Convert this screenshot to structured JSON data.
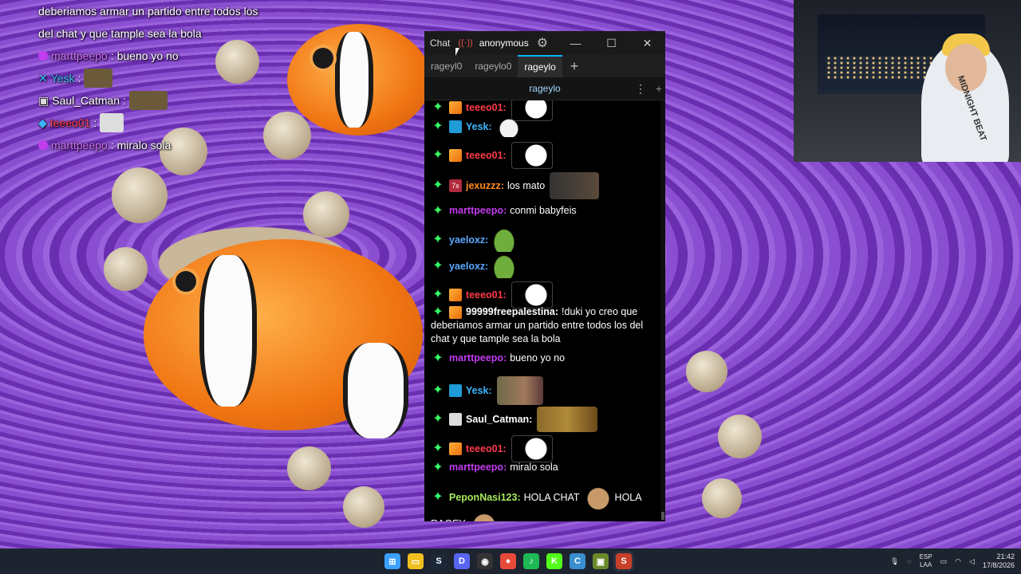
{
  "overlay_chat": {
    "line1": "deberiamos armar un partido entre todos los",
    "line2": "del chat y que tample sea la bola",
    "msgs": [
      {
        "user": "marttpeepo",
        "color": "#c23cf0",
        "text": ": bueno yo no"
      },
      {
        "user": "Yesk",
        "color": "#3ab7ff",
        "text": ":"
      },
      {
        "user": "Saul_Catman",
        "color": "#ffffff",
        "text": ":"
      },
      {
        "user": "teeeo01",
        "color": "#ff3b4a",
        "text": ":"
      },
      {
        "user": "marttpeepo",
        "color": "#c23cf0",
        "text": ": miralo sola"
      }
    ]
  },
  "chat_window": {
    "title": "Chat",
    "user": "anonymous",
    "window_controls": {
      "minimize": "—",
      "maximize": "☐",
      "close": "✕"
    },
    "tabs": [
      "rageyl0",
      "rageylo0",
      "rageylo"
    ],
    "selected_tab": "rageylo",
    "add_tab": "+",
    "channel": "rageylo",
    "menu_icon": "⋮",
    "split_add": "+"
  },
  "messages": [
    {
      "user": "teeeo01:",
      "color": "#ff3b4a",
      "badge": "cube",
      "text": "",
      "emote": "troll"
    },
    {
      "user": "Yesk:",
      "color": "#3ab7ff",
      "badge": "hammer",
      "text": "",
      "emote": "ghost"
    },
    {
      "user": "teeeo01:",
      "color": "#ff3b4a",
      "badge": "cube",
      "text": "",
      "emote": "troll"
    },
    {
      "user": "jexuzzz:",
      "color": "#ff8b1f",
      "badge": "7x",
      "text": "los mato",
      "emote": "boxing"
    },
    {
      "user": "marttpeepo:",
      "color": "#c23cf0",
      "badge": "",
      "text": "conmi babyfeis",
      "emote": ""
    },
    {
      "user": "yaeloxz:",
      "color": "#5aa9ff",
      "badge": "",
      "text": "",
      "emote": "pepe"
    },
    {
      "user": "yaeloxz:",
      "color": "#5aa9ff",
      "badge": "",
      "text": "",
      "emote": "pepe"
    },
    {
      "user": "teeeo01:",
      "color": "#ff3b4a",
      "badge": "cube",
      "text": "",
      "emote": "troll"
    },
    {
      "user": "99999freepalestina:",
      "color": "#ffffff",
      "badge": "cube",
      "text": "!duki yo creo que",
      "emote": ""
    },
    {
      "user": "",
      "color": "#ffffff",
      "badge": "",
      "text": "deberiamos armar un partido entre todos los del",
      "emote": ""
    },
    {
      "user": "",
      "color": "#ffffff",
      "badge": "",
      "text": "chat y que tample sea la bola",
      "emote": ""
    },
    {
      "user": "marttpeepo:",
      "color": "#c23cf0",
      "badge": "",
      "text": "bueno yo no",
      "emote": ""
    },
    {
      "user": "Yesk:",
      "color": "#3ab7ff",
      "badge": "hammer",
      "text": "",
      "emote": "mummy"
    },
    {
      "user": "Saul_Catman:",
      "color": "#ffffff",
      "badge": "cat",
      "text": "",
      "emote": "minions"
    },
    {
      "user": "teeeo01:",
      "color": "#ff3b4a",
      "badge": "cube",
      "text": "",
      "emote": "troll"
    },
    {
      "user": "marttpeepo:",
      "color": "#c23cf0",
      "badge": "",
      "text": "miralo sola",
      "emote": ""
    },
    {
      "user": "PeponNasi123:",
      "color": "#a6e85c",
      "badge": "",
      "text": "HOLA CHAT",
      "emote": "dog",
      "text2": "HOLA"
    },
    {
      "user": "",
      "color": "#ffffff",
      "badge": "",
      "text": "RAGEY",
      "emote": "dog"
    }
  ],
  "webcam": {
    "shirt_text": "MIDNIGHT BEAT"
  },
  "taskbar": {
    "apps": [
      {
        "name": "start",
        "glyph": "⊞",
        "color": "#3aa0ff"
      },
      {
        "name": "file-explorer",
        "glyph": "▭",
        "color": "#f0c020"
      },
      {
        "name": "steam",
        "glyph": "S",
        "color": "#1b2838"
      },
      {
        "name": "discord",
        "glyph": "D",
        "color": "#5865f2"
      },
      {
        "name": "obs",
        "glyph": "◉",
        "color": "#333333"
      },
      {
        "name": "chrome",
        "glyph": "●",
        "color": "#e84a3a"
      },
      {
        "name": "spotify",
        "glyph": "♪",
        "color": "#1db954"
      },
      {
        "name": "kick",
        "glyph": "K",
        "color": "#53fc18"
      },
      {
        "name": "chatterino",
        "glyph": "C",
        "color": "#3a8fd0"
      },
      {
        "name": "app-green",
        "glyph": "▣",
        "color": "#6a8a2a"
      },
      {
        "name": "steam-active",
        "glyph": "S",
        "color": "#c8402a"
      }
    ],
    "lang_top": "ESP",
    "lang_bottom": "LAA",
    "time": "21:42",
    "date": "17/8/2026"
  }
}
